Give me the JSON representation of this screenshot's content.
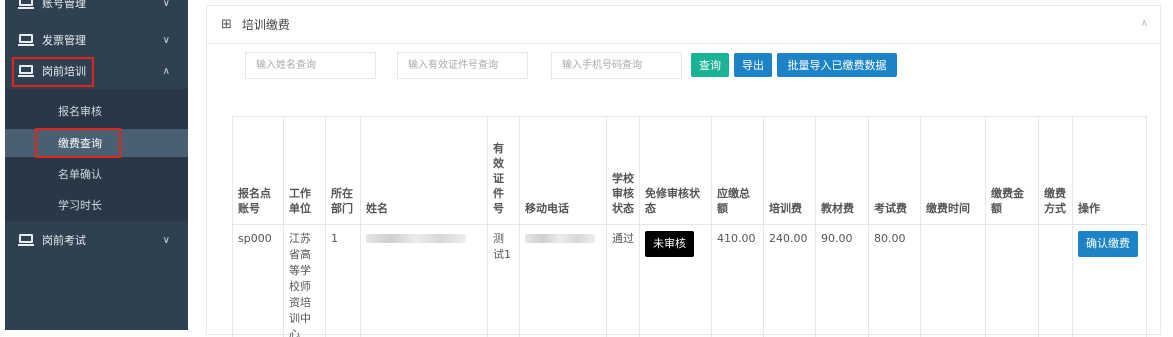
{
  "sidebar": {
    "items": [
      {
        "label": "账号管理",
        "chevron": "∨"
      },
      {
        "label": "发票管理",
        "chevron": "∨"
      },
      {
        "label": "岗前培训",
        "chevron": "∧"
      },
      {
        "label": "岗前考试",
        "chevron": "∨"
      }
    ],
    "sub_items": [
      {
        "label": "报名审核"
      },
      {
        "label": "缴费查询"
      },
      {
        "label": "名单确认"
      },
      {
        "label": "学习时长"
      }
    ]
  },
  "panel": {
    "title": "培训缴费",
    "grid_icon": "⊞",
    "collapse_icon": "∧"
  },
  "search": {
    "name_placeholder": "输入姓名查询",
    "id_placeholder": "输入有效证件号查询",
    "phone_placeholder": "输入手机号码查询"
  },
  "buttons": {
    "query": "查询",
    "export": "导出",
    "batch_import": "批量导入已缴费数据"
  },
  "table": {
    "headers": [
      "报名点账号",
      "工作单位",
      "所在部门",
      "姓名",
      "有效证件号",
      "移动电话",
      "学校审核状态",
      "免修审核状态",
      "应缴总额",
      "培训费",
      "教材费",
      "考试费",
      "缴费时间",
      "缴费金额",
      "缴费方式",
      "操作"
    ],
    "rows": [
      {
        "account": "sp000",
        "unit": "江苏省高等学校师资培训中心",
        "dept": "1",
        "name": "",
        "id_no": "测试1",
        "phone": "",
        "school_status": "通过",
        "exempt_status": "未审核",
        "total": "410.00",
        "training_fee": "240.00",
        "material_fee": "90.00",
        "exam_fee": "80.00",
        "pay_time": "",
        "pay_amount": "",
        "pay_method": "",
        "action": "确认缴费"
      }
    ]
  },
  "colors": {
    "sidebar_bg": "#2f4050",
    "highlight_red": "#e0251d",
    "green": "#1ab394",
    "blue": "#1c84c6"
  }
}
